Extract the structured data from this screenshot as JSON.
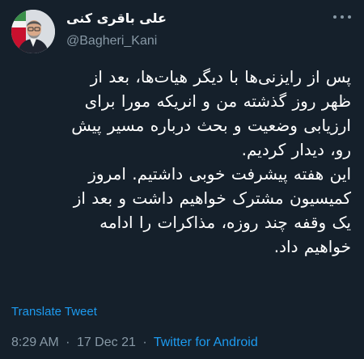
{
  "tweet": {
    "author": {
      "display_name": "علی باقری کنی",
      "handle": "@Bagheri_Kani",
      "avatar": "profile-photo"
    },
    "text": "پس از رایزنی‌ها با دیگر هیات‌ها، بعد از\nظهر روز گذشته من و انریکه مورا برای\nارزیابی وضعیت و بحث درباره مسیر پیش\nرو، دیدار کردیم.\nاین هفته پیشرفت خوبی داشتیم. امروز\nکمیسیون مشترک خواهیم داشت و بعد از\nیک وقفه چند روزه، مذاکرات را ادامه\nخواهیم داد.",
    "translate_label": "Translate Tweet",
    "time": "8:29 AM",
    "separator": "·",
    "date": "17 Dec 21",
    "source": "Twitter for Android"
  },
  "icons": {
    "more": "more-horizontal-icon"
  },
  "colors": {
    "background": "#15202b",
    "text": "#ffffff",
    "secondary": "#8899a6",
    "link": "#1d9bf0"
  }
}
